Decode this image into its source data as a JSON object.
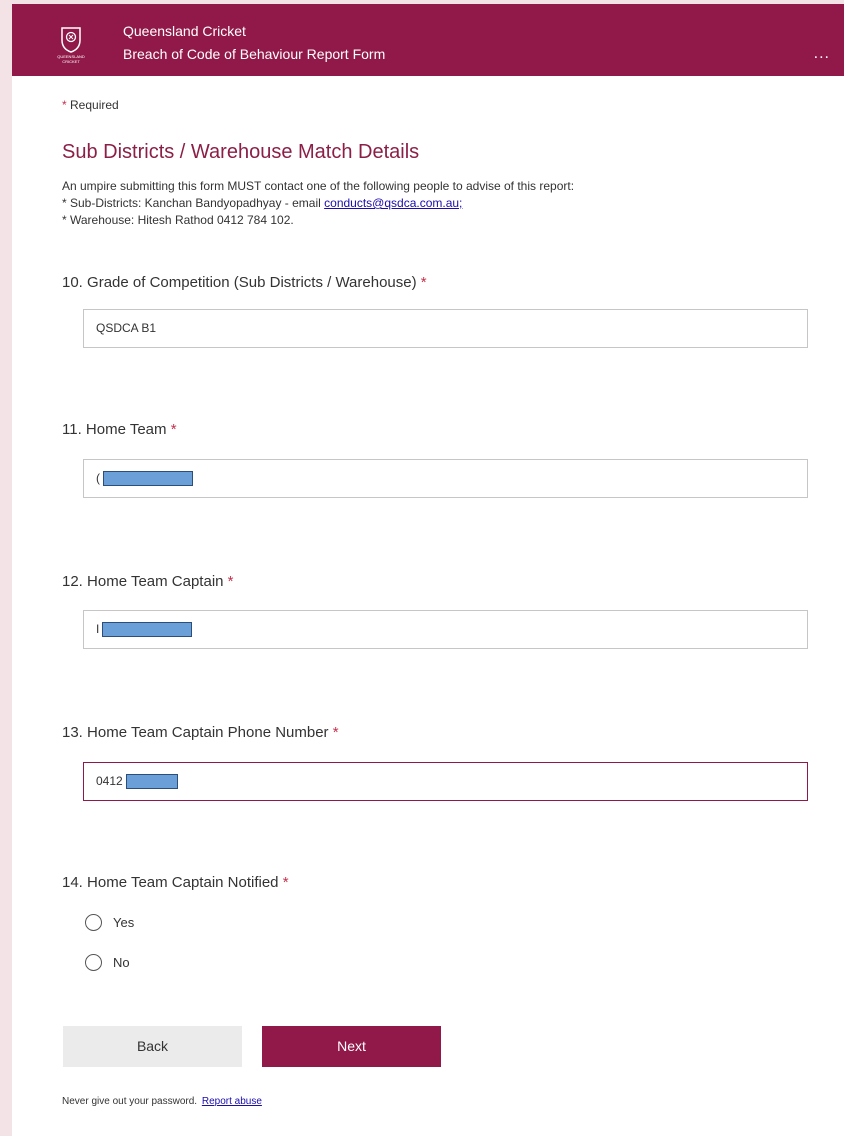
{
  "header": {
    "title": "Queensland Cricket",
    "subtitle": "Breach of Code of Behaviour Report Form",
    "more_label": "...",
    "logo_text": "QUEENSLAND CRICKET"
  },
  "required_note": {
    "star": "*",
    "text": "Required"
  },
  "section": {
    "title": "Sub Districts / Warehouse Match Details",
    "desc_line1": "An umpire submitting this form MUST contact one of the following people to advise of this report:",
    "desc_line2_prefix": "* Sub-Districts: Kanchan Bandyopadhyay - email ",
    "desc_line2_link": "conducts@qsdca.com.au;",
    "desc_line3": "* Warehouse: Hitesh Rathod 0412 784 102."
  },
  "questions": [
    {
      "number": "10.",
      "label": "Grade of Competition (Sub Districts / Warehouse)",
      "star": "*",
      "value": "QSDCA B1"
    },
    {
      "number": "11.",
      "label": "Home Team",
      "star": "*",
      "value": "("
    },
    {
      "number": "12.",
      "label": "Home Team Captain",
      "star": "*",
      "value": "I"
    },
    {
      "number": "13.",
      "label": "Home Team Captain Phone Number",
      "star": "*",
      "value": "0412"
    },
    {
      "number": "14.",
      "label": "Home Team Captain Notified",
      "star": "*",
      "options": [
        "Yes",
        "No"
      ]
    }
  ],
  "buttons": {
    "back": "Back",
    "next": "Next"
  },
  "footer": {
    "text": "Never give out your password.",
    "link": "Report abuse"
  },
  "colors": {
    "brand": "#911949",
    "section_title": "#8b1f47",
    "required_star": "#c4314b",
    "redaction": "#6a9fd8"
  }
}
